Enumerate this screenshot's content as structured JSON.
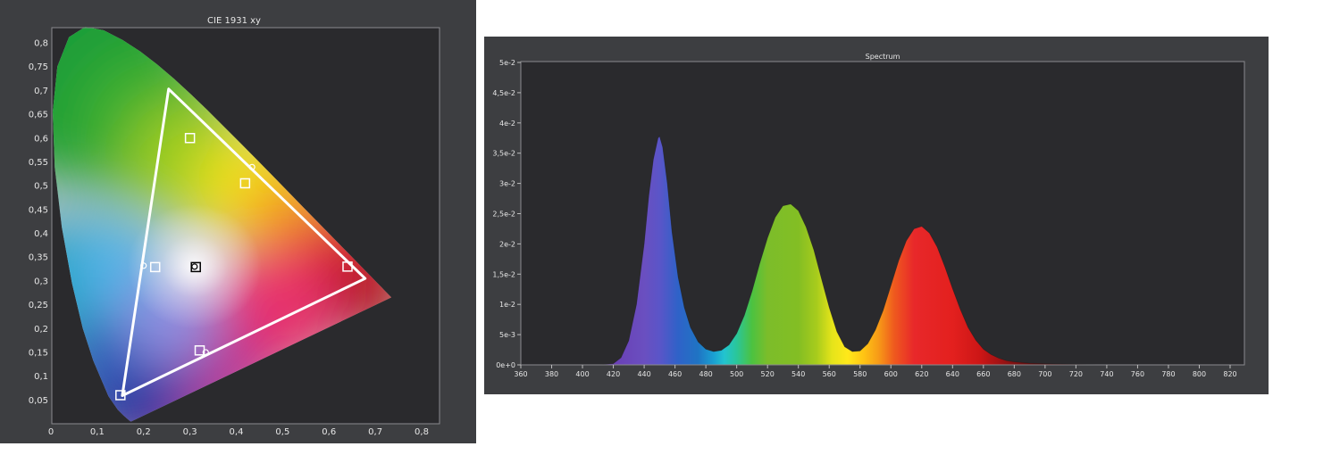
{
  "colors": {
    "panel_background": "#3d3e41",
    "plot_background": "#2a2a2d",
    "text": "#e6e6e6",
    "gamut_line": "#ffffff"
  },
  "chart_data": [
    {
      "type": "scatter",
      "title": "CIE 1931 xy",
      "xlabel": "",
      "ylabel": "",
      "xlim": [
        0,
        0.8
      ],
      "ylim": [
        0,
        0.85
      ],
      "x_ticks": [
        "0",
        "0,1",
        "0,2",
        "0,3",
        "0,4",
        "0,5",
        "0,6",
        "0,7",
        "0,8"
      ],
      "y_ticks": [
        "0,05",
        "0,1",
        "0,15",
        "0,2",
        "0,25",
        "0,3",
        "0,35",
        "0,4",
        "0,45",
        "0,5",
        "0,55",
        "0,6",
        "0,65",
        "0,7",
        "0,75",
        "0,8"
      ],
      "grid": false,
      "background": "CIE 1931 chromaticity horseshoe diagram",
      "series": [
        {
          "kind": "target-gamut-squares",
          "points": [
            {
              "x": 0.64,
              "y": 0.33
            },
            {
              "x": 0.3,
              "y": 0.6
            },
            {
              "x": 0.15,
              "y": 0.06
            },
            {
              "x": 0.225,
              "y": 0.329
            },
            {
              "x": 0.321,
              "y": 0.154
            },
            {
              "x": 0.419,
              "y": 0.505
            },
            {
              "x": 0.3127,
              "y": 0.329
            }
          ]
        },
        {
          "kind": "measured-gamut-triangle",
          "points": [
            {
              "x": 0.678,
              "y": 0.305
            },
            {
              "x": 0.254,
              "y": 0.703
            },
            {
              "x": 0.154,
              "y": 0.059
            }
          ]
        },
        {
          "kind": "measured-circles",
          "points": [
            {
              "x": 0.2,
              "y": 0.332
            },
            {
              "x": 0.334,
              "y": 0.15
            },
            {
              "x": 0.434,
              "y": 0.539
            },
            {
              "x": 0.31,
              "y": 0.33
            }
          ]
        }
      ]
    },
    {
      "type": "area",
      "title": "Spectrum",
      "xlabel": "",
      "ylabel": "",
      "xlim": [
        360,
        830
      ],
      "ylim": [
        0,
        0.05
      ],
      "x_ticks": [
        "360",
        "380",
        "400",
        "420",
        "440",
        "460",
        "480",
        "500",
        "520",
        "540",
        "560",
        "580",
        "600",
        "620",
        "640",
        "660",
        "680",
        "700",
        "720",
        "740",
        "760",
        "780",
        "800",
        "820"
      ],
      "y_ticks": [
        "0e+0",
        "5e-3",
        "1e-2",
        "1,5e-2",
        "2e-2",
        "2,5e-2",
        "3e-2",
        "3,5e-2",
        "4e-2",
        "4,5e-2",
        "5e-2"
      ],
      "grid": false,
      "fill": "wavelength spectrum colors",
      "x": [
        400,
        410,
        420,
        425,
        430,
        435,
        440,
        443,
        446,
        449,
        450,
        452,
        455,
        458,
        462,
        466,
        470,
        475,
        480,
        485,
        490,
        495,
        500,
        505,
        510,
        515,
        520,
        525,
        530,
        535,
        540,
        545,
        550,
        555,
        560,
        565,
        570,
        575,
        580,
        585,
        590,
        595,
        600,
        605,
        610,
        615,
        620,
        625,
        630,
        635,
        640,
        645,
        650,
        655,
        660,
        665,
        670,
        675,
        680,
        690,
        700,
        720,
        740,
        760,
        780
      ],
      "values": [
        0.0,
        0.0,
        0.0002,
        0.0012,
        0.004,
        0.01,
        0.02,
        0.028,
        0.034,
        0.0375,
        0.0378,
        0.036,
        0.03,
        0.022,
        0.0145,
        0.0095,
        0.0062,
        0.0038,
        0.0026,
        0.0022,
        0.0024,
        0.0033,
        0.0052,
        0.0082,
        0.0122,
        0.0168,
        0.021,
        0.0244,
        0.0263,
        0.0266,
        0.0255,
        0.0228,
        0.019,
        0.0142,
        0.0095,
        0.0055,
        0.003,
        0.0022,
        0.0023,
        0.0035,
        0.0058,
        0.009,
        0.0131,
        0.0172,
        0.0205,
        0.0225,
        0.0229,
        0.0218,
        0.0195,
        0.0162,
        0.0126,
        0.0092,
        0.0062,
        0.0041,
        0.0026,
        0.0017,
        0.0011,
        0.0007,
        0.0005,
        0.0003,
        0.0002,
        0.0001,
        0.0,
        0.0,
        0.0
      ]
    }
  ]
}
